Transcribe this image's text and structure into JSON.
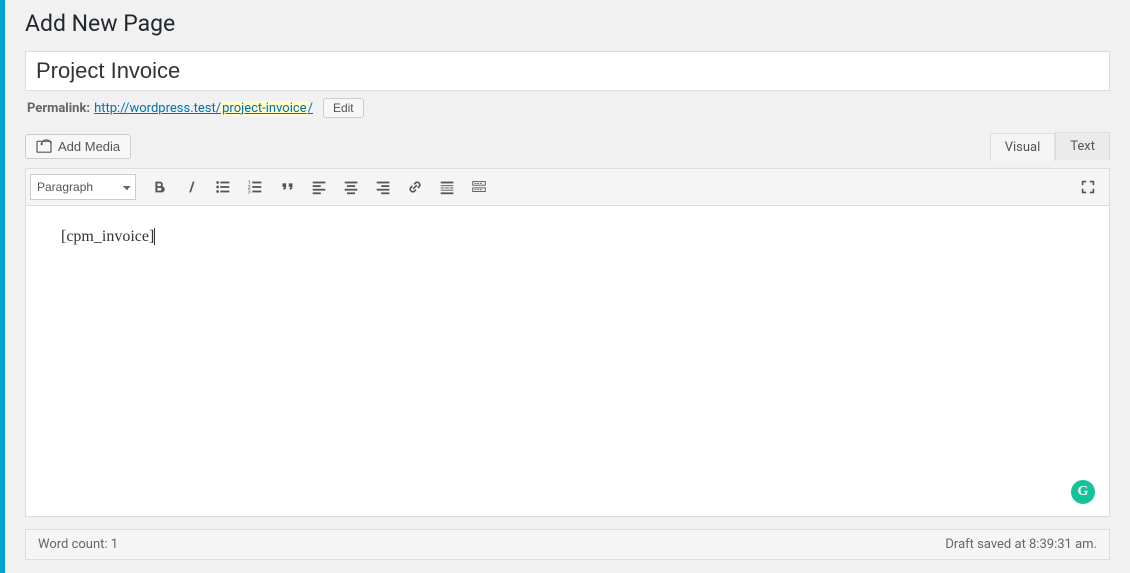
{
  "heading": "Add New Page",
  "title_value": "Project Invoice",
  "permalink": {
    "label": "Permalink:",
    "base": "http://wordpress.test/",
    "slug": "project-invoice",
    "trailing": "/",
    "edit": "Edit"
  },
  "buttons": {
    "add_media": "Add Media"
  },
  "tabs": {
    "visual": "Visual",
    "text": "Text"
  },
  "format_selected": "Paragraph",
  "content": "[cpm_invoice]",
  "grammar_badge": "G",
  "footer": {
    "word_count_label": "Word count: ",
    "word_count": "1",
    "draft_saved": "Draft saved at 8:39:31 am."
  }
}
